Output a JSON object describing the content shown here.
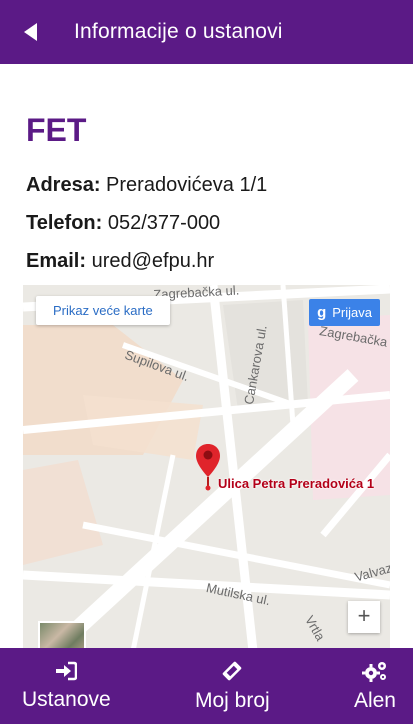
{
  "header": {
    "title": "Informacije o ustanovi",
    "back_icon": "back-arrow-icon"
  },
  "institution": {
    "name": "FET",
    "address_label": "Adresa:",
    "address": "Preradovićeva 1/1",
    "phone_label": "Telefon:",
    "phone": "052/377-000",
    "email_label": "Email:",
    "email": "ured@efpu.hr"
  },
  "map": {
    "larger_map": "Prikaz veće karte",
    "login": "Prijava",
    "login_g": "g",
    "pin_label": "Ulica Petra Preradovića 1",
    "zoom_in": "+",
    "streets": {
      "zagrebacka_top": "Zagrebačka ul.",
      "zagrebacka_right": "Zagrebačka",
      "supilova": "Supilova ul.",
      "cankarova": "Cankarova ul.",
      "mutilska": "Mutilska ul.",
      "valvaz": "Valvaz",
      "vrtla": "Vrtla"
    }
  },
  "nav": {
    "items": [
      {
        "label": "Ustanove",
        "icon": "sign-in-icon"
      },
      {
        "label": "Moj broj",
        "icon": "ticket-icon"
      },
      {
        "label": "Alen",
        "icon": "gears-icon"
      }
    ]
  },
  "colors": {
    "primary": "#5b1a86",
    "pin": "#e0242b",
    "map_bg": "#ebe9e4"
  }
}
